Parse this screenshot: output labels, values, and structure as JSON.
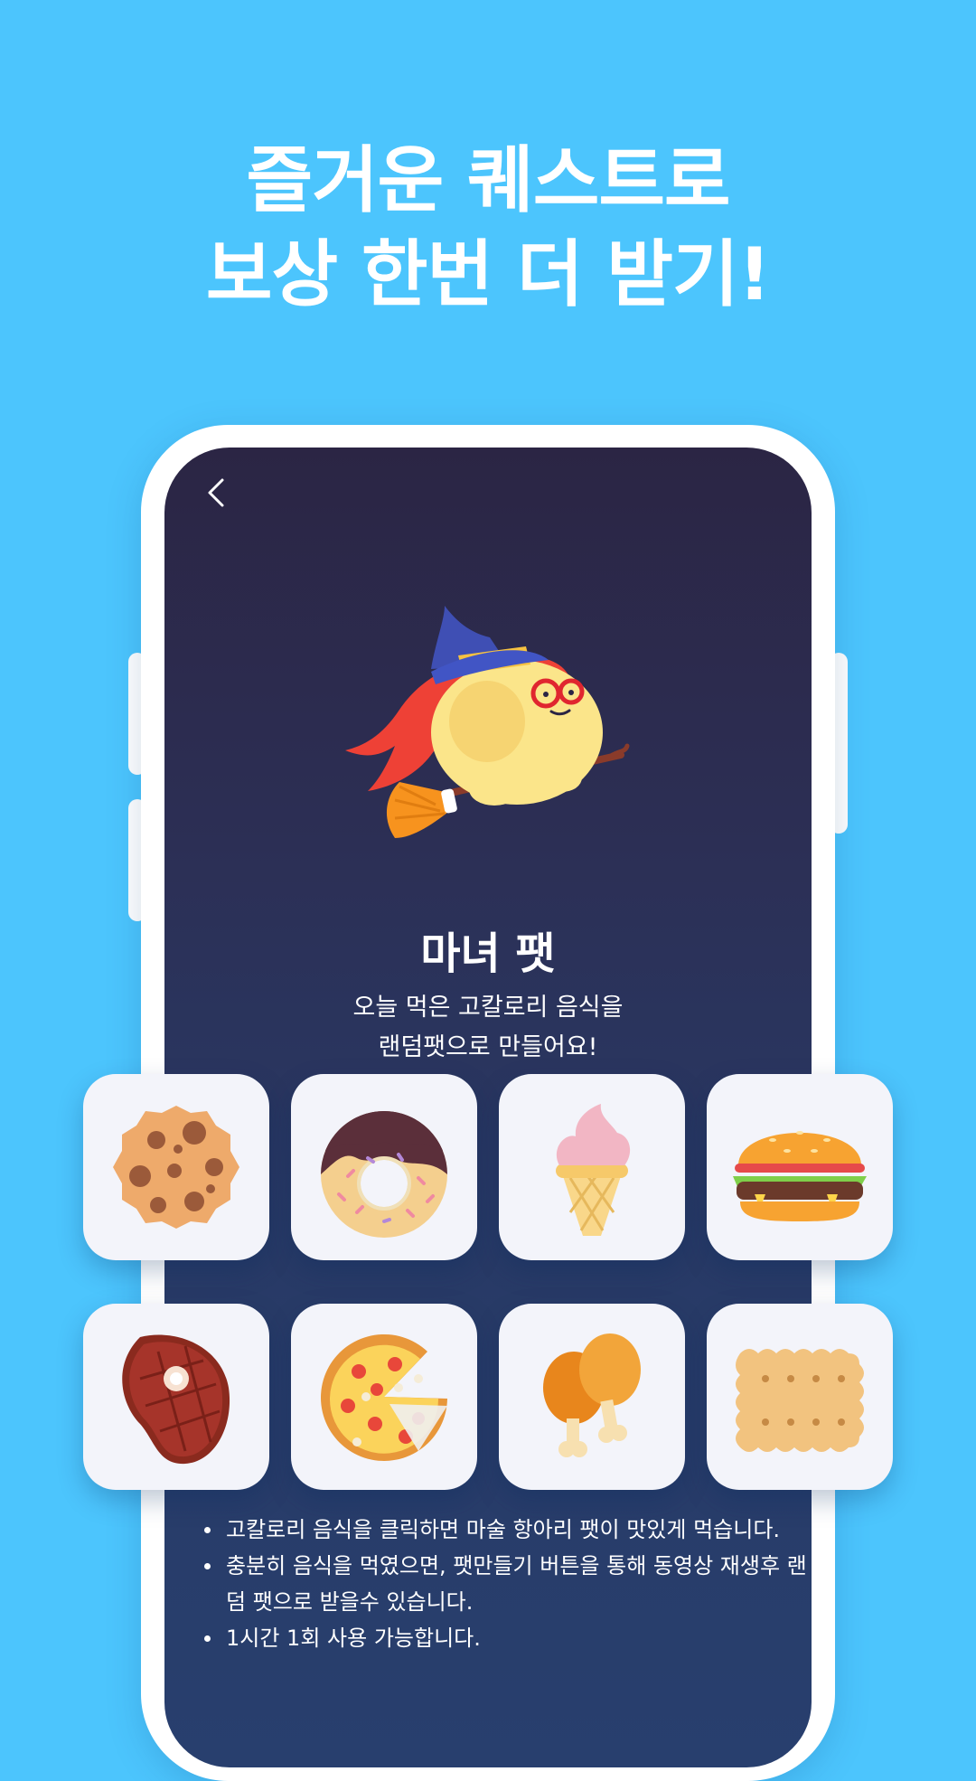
{
  "headline": {
    "line1": "즐거운 퀘스트로",
    "line2": "보상 한번 더 받기!"
  },
  "screen": {
    "back_icon": "chevron-left-icon",
    "pet_name": "마녀 팻",
    "description_line1": "오늘 먹은 고칼로리 음식을",
    "description_line2": "랜덤팻으로 만들어요!",
    "foods": [
      "cookie",
      "donut",
      "ice-cream",
      "hamburger",
      "steak",
      "pizza",
      "chicken-drumsticks",
      "biscuit"
    ],
    "notes": [
      "고칼로리 음식을 클릭하면 마술 항아리 팻이 맛있게 먹습니다.",
      "충분히 음식을 먹였으면, 팻만들기 버튼을 통해 동영상 재생후 랜덤 팻으로 받을수 있습니다.",
      "1시간 1회 사용 가능합니다."
    ]
  },
  "colors": {
    "background": "#4cc5fd",
    "screen_top": "#2b2544",
    "screen_bottom": "#283f6e",
    "tile": "#f3f4fa"
  }
}
